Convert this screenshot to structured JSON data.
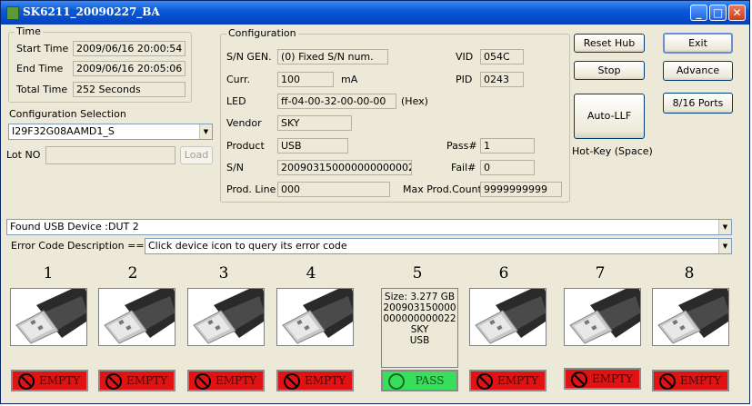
{
  "window": {
    "title": "SK6211_20090227_BA",
    "minimize": "_",
    "maximize": "□",
    "close": "✕"
  },
  "time": {
    "legend": "Time",
    "start_label": "Start Time",
    "start_value": "2009/06/16 20:00:54",
    "end_label": "End Time",
    "end_value": "2009/06/16 20:05:06",
    "total_label": "Total Time",
    "total_value": "252 Seconds"
  },
  "config_selection": {
    "label": "Configuration Selection",
    "value": "I29F32G08AAMD1_S"
  },
  "lot": {
    "label": "Lot NO",
    "value": "",
    "load_button": "Load"
  },
  "configuration": {
    "legend": "Configuration",
    "sn_gen_label": "S/N GEN.",
    "sn_gen_value": "(0) Fixed S/N num.",
    "curr_label": "Curr.",
    "curr_value": "100",
    "curr_unit": "mA",
    "led_label": "LED",
    "led_value": "ff-04-00-32-00-00-00",
    "led_unit": "(Hex)",
    "vendor_label": "Vendor",
    "vendor_value": "SKY",
    "product_label": "Product",
    "product_value": "USB",
    "sn_label": "S/N",
    "sn_value": "2009031500000000000022",
    "prodline_label": "Prod. Line",
    "prodline_value": "000",
    "vid_label": "VID",
    "vid_value": "054C",
    "pid_label": "PID",
    "pid_value": "0243",
    "pass_label": "Pass#",
    "pass_value": "1",
    "fail_label": "Fail#",
    "fail_value": "0",
    "maxprod_label": "Max Prod.Count",
    "maxprod_value": "9999999999"
  },
  "buttons": {
    "reset_hub": "Reset Hub",
    "stop": "Stop",
    "auto_llf": "Auto-LLF",
    "hotkey": "Hot-Key (Space)",
    "exit": "Exit",
    "advance": "Advance",
    "ports": "8/16 Ports"
  },
  "status_bar": {
    "found_device": "Found USB Device :DUT 2",
    "error_label": "Error Code Description ==>",
    "error_value": "Click device icon to query its error code"
  },
  "ports": [
    {
      "number": "1",
      "status": "EMPTY"
    },
    {
      "number": "2",
      "status": "EMPTY"
    },
    {
      "number": "3",
      "status": "EMPTY"
    },
    {
      "number": "4",
      "status": "EMPTY"
    },
    {
      "number": "5",
      "status": "PASS",
      "info": [
        "Size: 3.277 GB",
        "200903150000",
        "000000000022",
        "SKY",
        "USB"
      ]
    },
    {
      "number": "6",
      "status": "EMPTY"
    },
    {
      "number": "7",
      "status": "EMPTY"
    },
    {
      "number": "8",
      "status": "EMPTY"
    }
  ],
  "colors": {
    "title_bar": "#0a5ad6",
    "empty": "#e01212",
    "pass": "#37e05a"
  }
}
